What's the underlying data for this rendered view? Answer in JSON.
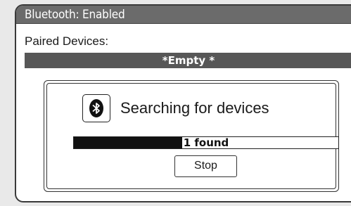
{
  "status_bar": {
    "text": "Bluetooth: Enabled"
  },
  "paired_devices": {
    "label": "Paired Devices:",
    "empty_text": "*Empty *"
  },
  "search_dialog": {
    "icon": "bluetooth-icon",
    "message": "Searching for devices",
    "progress": {
      "label": "1 found",
      "fraction": 0.41
    },
    "stop_label": "Stop"
  },
  "colors": {
    "status_bar_bg": "#6b6b6b",
    "empty_row_bg": "#575757",
    "progress_fill": "#111111"
  }
}
